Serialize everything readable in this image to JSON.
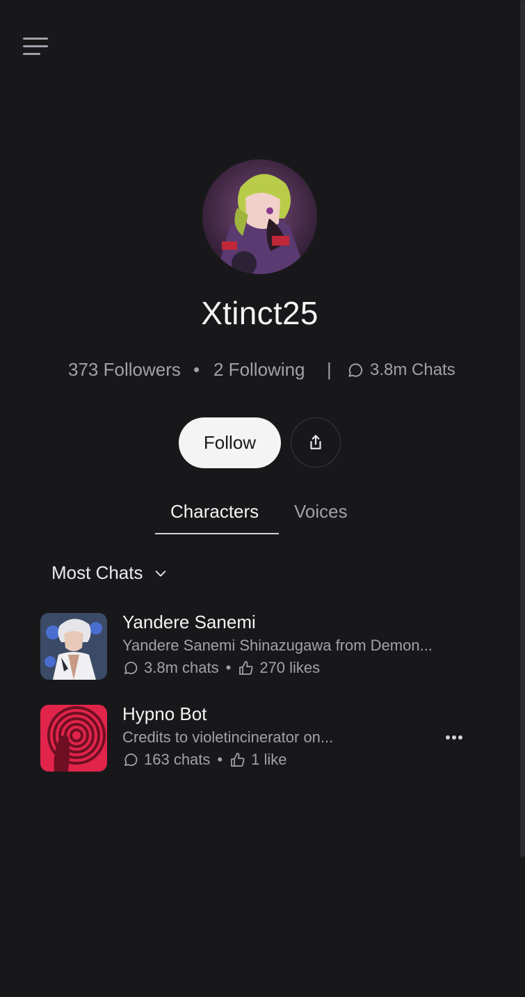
{
  "profile": {
    "username": "Xtinct25",
    "followers": "373 Followers",
    "following": "2 Following",
    "separator_dot": "•",
    "separator_bar": "|",
    "chats": "3.8m Chats"
  },
  "actions": {
    "follow_label": "Follow"
  },
  "tabs": [
    {
      "label": "Characters",
      "active": true
    },
    {
      "label": "Voices",
      "active": false
    }
  ],
  "sort": {
    "label": "Most Chats"
  },
  "characters": [
    {
      "name": "Yandere Sanemi",
      "description": "Yandere Sanemi Shinazugawa from Demon...",
      "chats": "3.8m chats",
      "likes": "270 likes",
      "separator": "•"
    },
    {
      "name": "Hypno Bot",
      "description": "Credits to violetincinerator on...",
      "chats": "163 chats",
      "likes": "1 like",
      "separator": "•"
    }
  ],
  "colors": {
    "background": "#18181b",
    "text_primary": "#f4f4f5",
    "text_secondary": "#a1a1aa",
    "follow_button_bg": "#f4f4f5"
  }
}
